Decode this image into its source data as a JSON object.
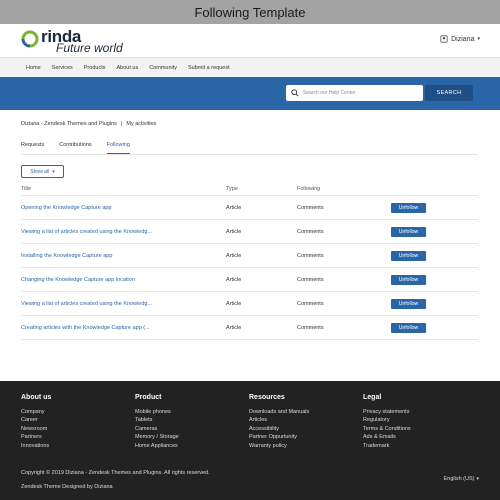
{
  "window": {
    "title": "Following Template"
  },
  "brand": {
    "name": "rinda",
    "tagline": "Future world"
  },
  "user": {
    "name": "Diziana"
  },
  "nav": [
    "Home",
    "Services",
    "Products",
    "About us",
    "Community",
    "Submit a request"
  ],
  "search": {
    "placeholder": "Search our Help Center",
    "button": "SEARCH"
  },
  "breadcrumb": {
    "root": "Diziana - Zendesk Themes and Plugins",
    "separator": "|",
    "current": "My activities"
  },
  "tabs": [
    {
      "label": "Requests",
      "active": false
    },
    {
      "label": "Contributions",
      "active": false
    },
    {
      "label": "Following",
      "active": true
    }
  ],
  "filter": {
    "label": "Show all"
  },
  "table": {
    "headers": {
      "title": "Title",
      "type": "Type",
      "following": "Following"
    },
    "action_label": "Unfollow",
    "rows": [
      {
        "title": "Opening the Knowledge Capture app",
        "type": "Article",
        "following": "Comments"
      },
      {
        "title": "Viewing a list of articles created using the Knowledg...",
        "type": "Article",
        "following": "Comments"
      },
      {
        "title": "Installing the Knowledge Capture app",
        "type": "Article",
        "following": "Comments"
      },
      {
        "title": "Changing the Knowledge Capture app location",
        "type": "Article",
        "following": "Comments"
      },
      {
        "title": "Viewing a list of articles created using the Knowledg...",
        "type": "Article",
        "following": "Comments"
      },
      {
        "title": "Creating articles with the Knowledge Capture app (...",
        "type": "Article",
        "following": "Comments"
      }
    ]
  },
  "footer": {
    "columns": [
      {
        "heading": "About us",
        "links": [
          "Company",
          "Career",
          "Newsroom",
          "Partners",
          "Innovations"
        ]
      },
      {
        "heading": "Product",
        "links": [
          "Mobile phones",
          "Tablets",
          "Cameras",
          "Memory / Storage",
          "Home Appliances"
        ]
      },
      {
        "heading": "Resources",
        "links": [
          "Downloads and Manuals",
          "Articles",
          "Accessibility",
          "Partner Oppurtunity",
          "Warranty policy"
        ]
      },
      {
        "heading": "Legal",
        "links": [
          "Privacy statements",
          "Regulatory",
          "Terms & Conditions",
          "Ads & Emails",
          "Trademark"
        ]
      }
    ],
    "copyright": "Copyright © 2019 Diziana - Zendesk Themes and Plugins. All rights reserved.",
    "credit": "Zendesk Theme Designed by Diziana",
    "language": "English (US)"
  },
  "colors": {
    "primary": "#2a66a7",
    "hero": "#2a66a7",
    "footer": "#222222",
    "logo_green": "#7ab32e"
  }
}
